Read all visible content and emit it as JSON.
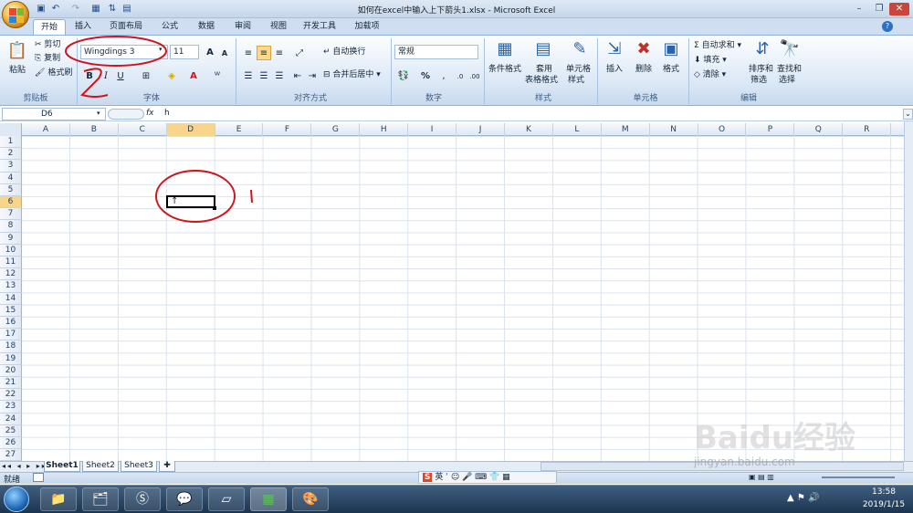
{
  "window": {
    "title": "如何在excel中输入上下箭头1.xlsx - Microsoft Excel",
    "minimize_icon": "minimize-icon",
    "restore_icon": "restore-icon",
    "close_icon": "close-icon"
  },
  "tabs": [
    {
      "label": "开始",
      "active": true
    },
    {
      "label": "插入"
    },
    {
      "label": "页面布局"
    },
    {
      "label": "公式"
    },
    {
      "label": "数据"
    },
    {
      "label": "审阅"
    },
    {
      "label": "视图"
    },
    {
      "label": "开发工具"
    },
    {
      "label": "加载项"
    }
  ],
  "ribbon": {
    "clipboard": {
      "paste": "粘贴",
      "cut": "剪切",
      "copy": "复制",
      "format_painter": "格式刷",
      "label": "剪贴板"
    },
    "font": {
      "name": "Wingdings 3",
      "size": "11",
      "bold": "B",
      "italic": "I",
      "underline": "U",
      "label": "字体"
    },
    "alignment": {
      "wrap": "自动换行",
      "merge": "合并后居中",
      "label": "对齐方式"
    },
    "number": {
      "format": "常规",
      "percent": "%",
      "label": "数字"
    },
    "styles": {
      "conditional": "条件格式",
      "table_format_1": "套用",
      "table_format_2": "表格格式",
      "cell_style_1": "单元格",
      "cell_style_2": "样式",
      "label": "样式"
    },
    "cells": {
      "insert": "插入",
      "delete": "删除",
      "format": "格式",
      "label": "单元格"
    },
    "editing": {
      "autosum": "自动求和",
      "fill": "填充",
      "clear": "清除",
      "sort_1": "排序和",
      "sort_2": "筛选",
      "find_1": "查找和",
      "find_2": "选择",
      "label": "编辑"
    }
  },
  "formula_bar": {
    "name_box": "D6",
    "fx": "fx",
    "content": "h"
  },
  "columns": [
    "A",
    "B",
    "C",
    "D",
    "E",
    "F",
    "G",
    "H",
    "I",
    "J",
    "K",
    "L",
    "M",
    "N",
    "O",
    "P",
    "Q",
    "R"
  ],
  "rows": [
    "1",
    "2",
    "3",
    "4",
    "5",
    "6",
    "7",
    "8",
    "9",
    "10",
    "11",
    "12",
    "13",
    "14",
    "15",
    "16",
    "17",
    "18",
    "19",
    "20",
    "21",
    "22",
    "23",
    "24",
    "25",
    "26",
    "27"
  ],
  "active_cell": {
    "ref": "D6",
    "value": "↑"
  },
  "annotations": {
    "mark_1": "1",
    "mark_2": "2"
  },
  "sheets": [
    "Sheet1",
    "Sheet2",
    "Sheet3"
  ],
  "status": {
    "ready": "就绪",
    "ime": "英"
  },
  "taskbar": {
    "time": "13:58",
    "date": "2019/1/15"
  },
  "watermark": {
    "line1": "Baidu经验",
    "line2": "jingyan.baidu.com"
  },
  "colors": {
    "ribbon_bg": "#dae7f5",
    "annotation": "#d0141e",
    "active_col": "#f7d58b"
  }
}
